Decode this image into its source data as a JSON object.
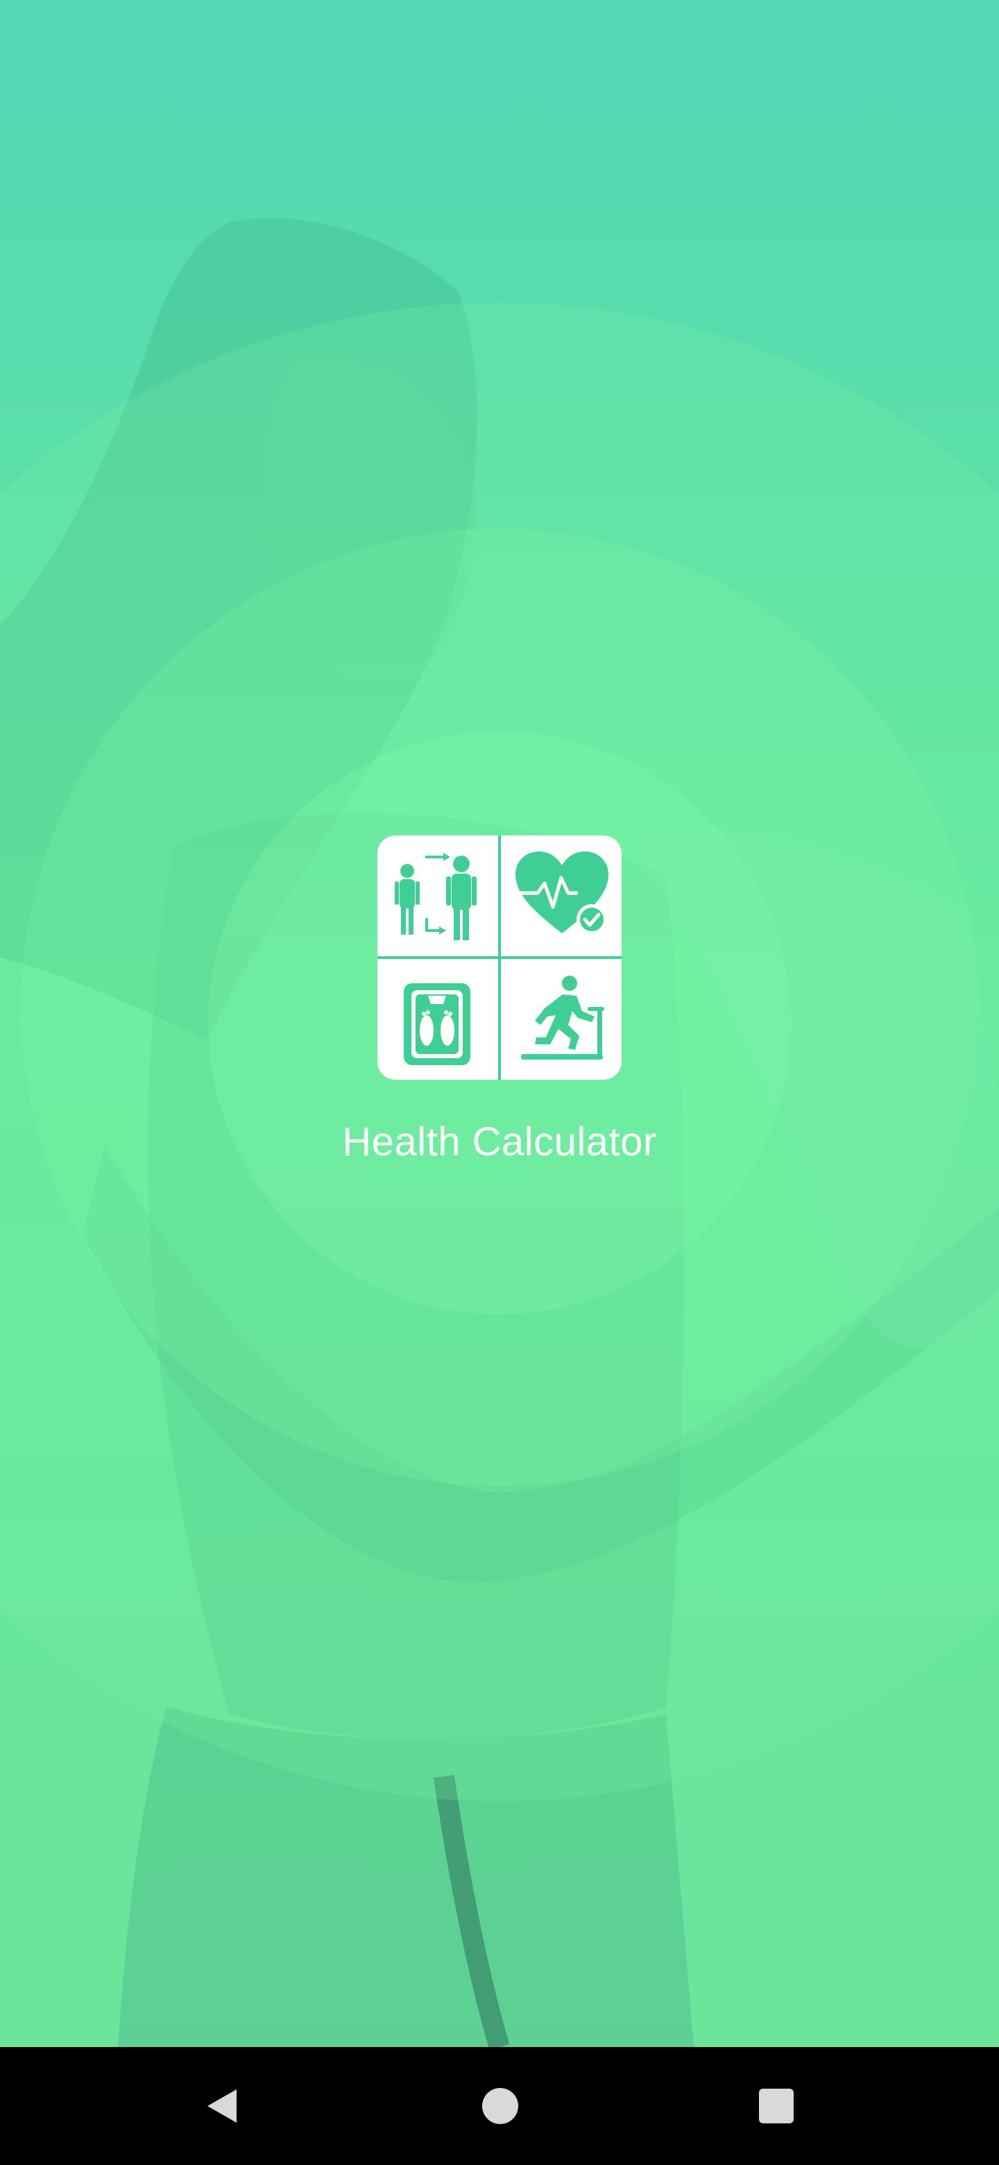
{
  "app": {
    "title": "Health Calculator"
  },
  "logo": {
    "tiles": [
      {
        "icon": "people-height-icon"
      },
      {
        "icon": "heart-check-icon"
      },
      {
        "icon": "weight-scale-icon"
      },
      {
        "icon": "treadmill-runner-icon"
      }
    ],
    "accent_color": "#3fcf94"
  },
  "background": {
    "gradient_top": "#52d8b6",
    "gradient_bottom": "#6ce39c"
  },
  "nav_bar": {
    "buttons": [
      {
        "icon": "back-triangle-icon"
      },
      {
        "icon": "home-circle-icon"
      },
      {
        "icon": "recents-square-icon"
      }
    ]
  }
}
